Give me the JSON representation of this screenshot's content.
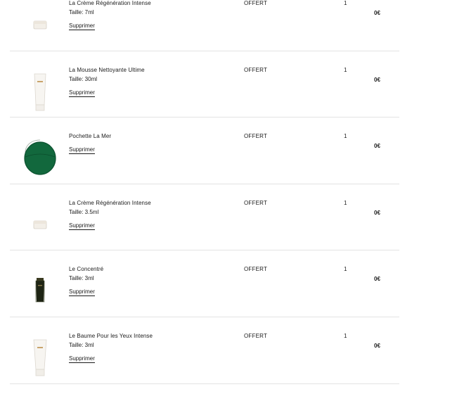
{
  "cart": {
    "items": [
      {
        "name": "La Crème Régénération Intense",
        "size": "Taille: 7ml",
        "remove": "Supprimer",
        "offer": "OFFERT",
        "qty": "1",
        "price": "0€",
        "icon": "cream-jar-icon"
      },
      {
        "name": "La Mousse Nettoyante Ultime",
        "size": "Taille: 30ml",
        "remove": "Supprimer",
        "offer": "OFFERT",
        "qty": "1",
        "price": "0€",
        "icon": "white-tube-icon"
      },
      {
        "name": "Pochette La Mer",
        "size": "",
        "remove": "Supprimer",
        "offer": "OFFERT",
        "qty": "1",
        "price": "0€",
        "icon": "green-pouch-icon"
      },
      {
        "name": "La Crème Régénération Intense",
        "size": "Taille: 3.5ml",
        "remove": "Supprimer",
        "offer": "OFFERT",
        "qty": "1",
        "price": "0€",
        "icon": "cream-jar-icon"
      },
      {
        "name": "Le Concentré",
        "size": "Taille: 3ml",
        "remove": "Supprimer",
        "offer": "OFFERT",
        "qty": "1",
        "price": "0€",
        "icon": "dark-tube-icon"
      },
      {
        "name": "Le Baume Pour les Yeux Intense",
        "size": "Taille: 3ml",
        "remove": "Supprimer",
        "offer": "OFFERT",
        "qty": "1",
        "price": "0€",
        "icon": "white-tube-icon"
      }
    ]
  }
}
